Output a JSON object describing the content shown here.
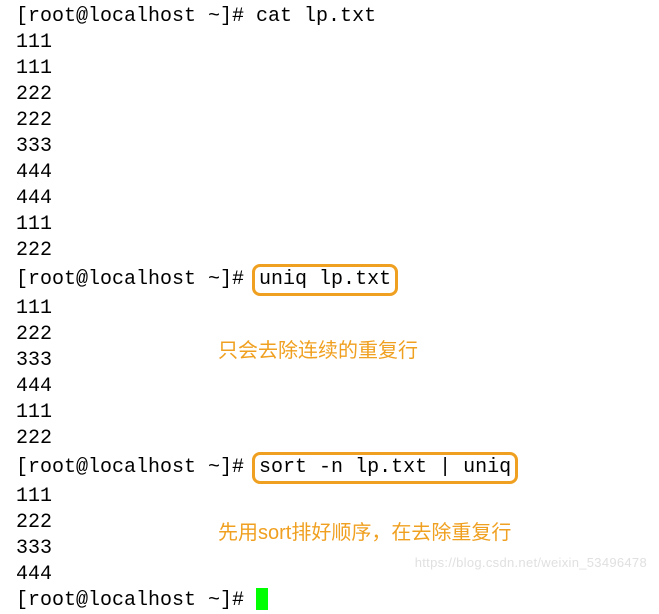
{
  "prompt": "[root@localhost ~]# ",
  "commands": {
    "cmd1": "cat lp.txt",
    "cmd2": "uniq lp.txt",
    "cmd3": "sort -n lp.txt | uniq"
  },
  "output1": [
    "111",
    "111",
    "222",
    "222",
    "333",
    "444",
    "444",
    "111",
    "222"
  ],
  "output2": [
    "111",
    "222",
    "333",
    "444",
    "111",
    "222"
  ],
  "output3": [
    "111",
    "222",
    "333",
    "444"
  ],
  "annotations": {
    "note1": "只会去除连续的重复行",
    "note2": "先用sort排好顺序，在去除重复行"
  },
  "watermark": "https://blog.csdn.net/weixin_53496478"
}
